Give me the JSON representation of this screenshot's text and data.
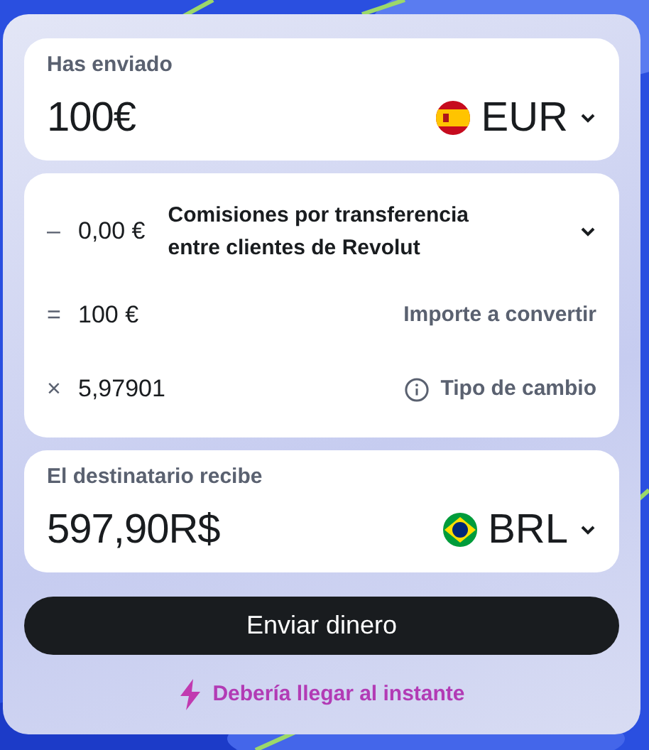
{
  "sent": {
    "label": "Has enviado",
    "amount": "100€",
    "currency": "EUR",
    "kind": "es"
  },
  "breakdown": [
    {
      "operator": "–",
      "amount": "0,00 €",
      "label": "Comisiones por transferencia entre clientes de Revolut",
      "kind": "expandable"
    },
    {
      "operator": "=",
      "amount": "100 €",
      "label": "Importe a convertir",
      "kind": "plain"
    },
    {
      "operator": "×",
      "amount": "5,97901",
      "label": "Tipo de cambio",
      "kind": "info"
    }
  ],
  "received": {
    "label": "El destinatario recibe",
    "amount": "597,90R$",
    "currency": "BRL",
    "kind": "br"
  },
  "button": "Enviar dinero",
  "note": "Debería llegar al instante"
}
